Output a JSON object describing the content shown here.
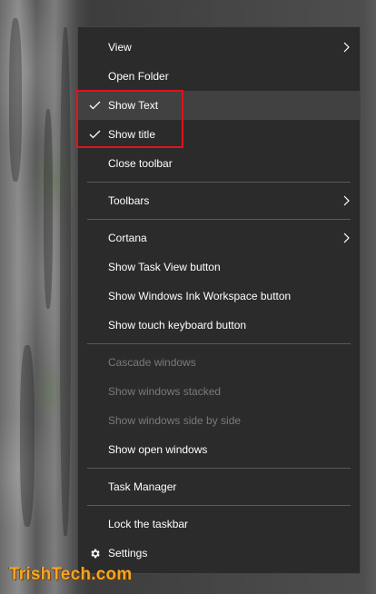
{
  "menu": {
    "view": "View",
    "open_folder": "Open Folder",
    "show_text": "Show Text",
    "show_title": "Show title",
    "close_toolbar": "Close toolbar",
    "toolbars": "Toolbars",
    "cortana": "Cortana",
    "show_task_view": "Show Task View button",
    "show_ink_workspace": "Show Windows Ink Workspace button",
    "show_touch_keyboard": "Show touch keyboard button",
    "cascade_windows": "Cascade windows",
    "show_windows_stacked": "Show windows stacked",
    "show_windows_side_by_side": "Show windows side by side",
    "show_open_windows": "Show open windows",
    "task_manager": "Task Manager",
    "lock_taskbar": "Lock the taskbar",
    "settings": "Settings"
  },
  "icons": {
    "check": "check-icon",
    "submenu": "chevron-right-icon",
    "settings": "gear-icon"
  },
  "colors": {
    "menu_bg": "#2b2b2b",
    "hover_bg": "#414141",
    "text": "#ffffff",
    "disabled_text": "#7a7a7a",
    "highlight_border": "#e3121c",
    "watermark": "#f5a623"
  },
  "watermark": "TrishTech.com"
}
